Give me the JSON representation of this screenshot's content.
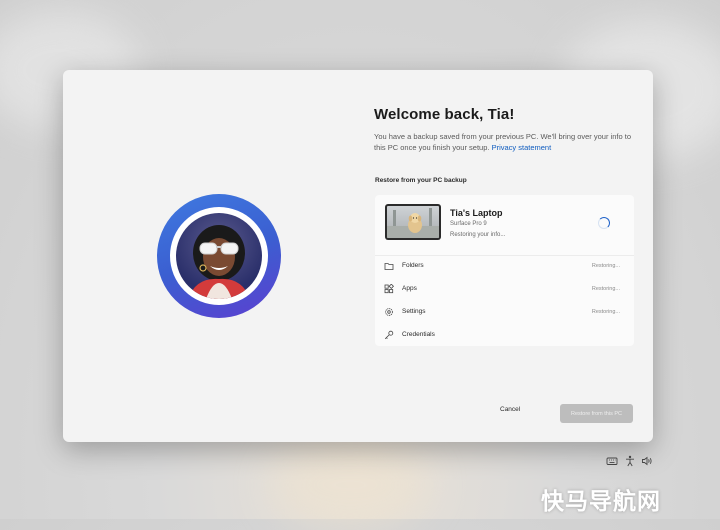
{
  "welcome": {
    "title": "Welcome back, Tia!",
    "description": "You have a backup saved from your previous PC. We'll bring over your info to this PC once you finish your setup.",
    "privacy_link": "Privacy statement"
  },
  "backup": {
    "section_label": "Restore from your PC backup",
    "device": {
      "name": "Tia's Laptop",
      "model": "Surface Pro 9",
      "status": "Restoring your info..."
    },
    "items": [
      {
        "label": "Folders",
        "status": "Restoring...",
        "icon": "folder-icon"
      },
      {
        "label": "Apps",
        "status": "Restoring...",
        "icon": "apps-icon"
      },
      {
        "label": "Settings",
        "status": "Restoring...",
        "icon": "gear-icon"
      },
      {
        "label": "Credentials",
        "status": "",
        "icon": "key-icon"
      }
    ]
  },
  "buttons": {
    "cancel": "Cancel",
    "restore": "Restore from this PC"
  },
  "tray_icons": [
    "keyboard-icon",
    "accessibility-icon",
    "volume-icon"
  ],
  "watermark": "快马导航网",
  "colors": {
    "accent": "#0f5cbf",
    "avatar_ring": "#4056d6",
    "disabled_button": "#bdbdbd"
  }
}
